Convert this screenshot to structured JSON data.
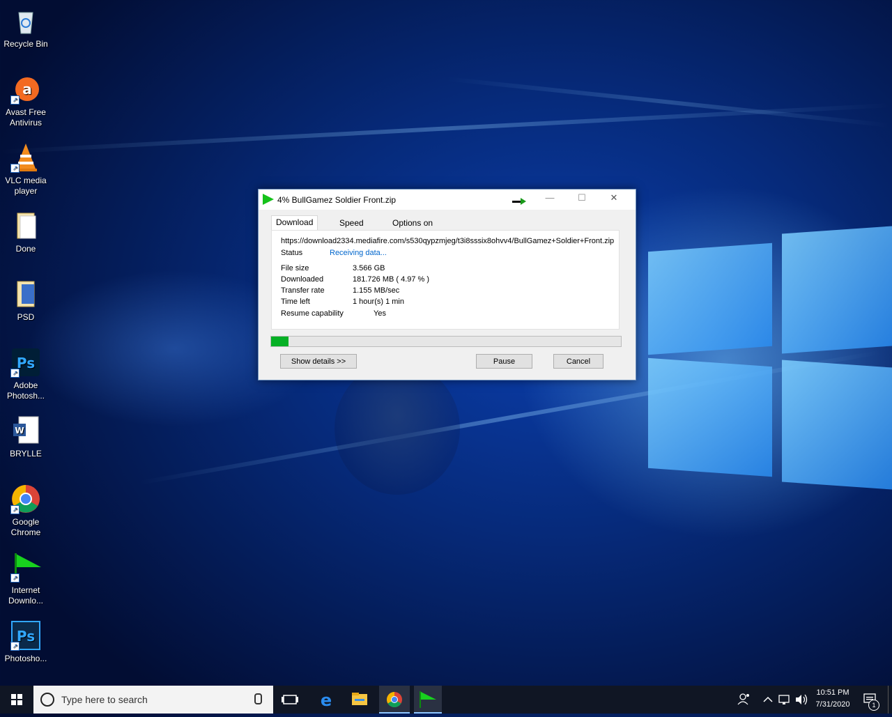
{
  "desktop": {
    "icons": [
      {
        "label": "Recycle Bin"
      },
      {
        "label": "Avast Free Antivirus"
      },
      {
        "label": "VLC media player"
      },
      {
        "label": "Done"
      },
      {
        "label": "PSD"
      },
      {
        "label": "Adobe Photosh..."
      },
      {
        "label": "BRYLLE"
      },
      {
        "label": "Google Chrome"
      },
      {
        "label": "Internet Downlo..."
      },
      {
        "label": "Photosho..."
      }
    ]
  },
  "dialog": {
    "title": "4% BullGamez Soldier Front.zip",
    "tabs": [
      "Download status",
      "Speed Limiter",
      "Options on completion"
    ],
    "url": "https://download2334.mediafire.com/s530qypzmjeg/t3i8sssix8ohvv4/BullGamez+Soldier+Front.zip",
    "status_label": "Status",
    "status_value": "Receiving data...",
    "fields": {
      "file_size_label": "File size",
      "file_size_value": "3.566  GB",
      "downloaded_label": "Downloaded",
      "downloaded_value": "181.726  MB  ( 4.97 % )",
      "transfer_rate_label": "Transfer rate",
      "transfer_rate_value": "1.155  MB/sec",
      "time_left_label": "Time left",
      "time_left_value": "1 hour(s) 1 min",
      "resume_label": "Resume capability",
      "resume_value": "Yes"
    },
    "progress_percent": 4.97,
    "buttons": {
      "show_details": "Show details >>",
      "pause": "Pause",
      "cancel": "Cancel"
    },
    "window_controls": {
      "minimize": "—",
      "maximize": "☐",
      "close": "✕"
    }
  },
  "taskbar": {
    "search_placeholder": "Type here to search",
    "time": "10:51 PM",
    "date": "7/31/2020",
    "notification_count": "1"
  },
  "colors": {
    "progress": "#06b025",
    "status_link": "#0066cc",
    "taskbar": "#101624"
  }
}
